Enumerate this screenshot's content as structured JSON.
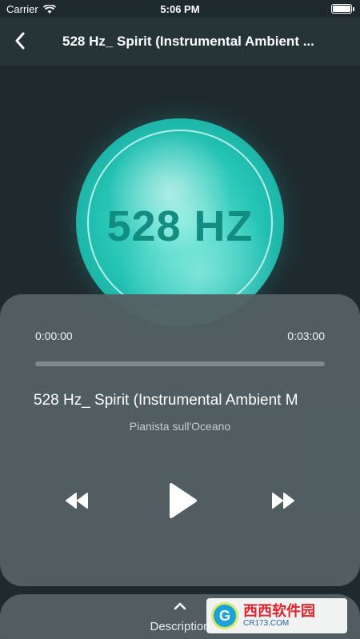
{
  "status_bar": {
    "carrier": "Carrier",
    "time": "5:06 PM",
    "icons": [
      "wifi-icon",
      "battery-icon"
    ]
  },
  "nav": {
    "back_icon": "chevron-left-icon",
    "title": "528 Hz_ Spirit (Instrumental Ambient ..."
  },
  "artwork": {
    "text": "528 HZ"
  },
  "player": {
    "current_time": "0:00:00",
    "total_time": "0:03:00",
    "progress_percent": 0,
    "track_title": "528 Hz_ Spirit (Instrumental Ambient M",
    "artist": "Pianista sull'Oceano",
    "controls": {
      "rewind_icon": "rewind-icon",
      "play_icon": "play-icon",
      "forward_icon": "fast-forward-icon"
    }
  },
  "description": {
    "icon": "chevron-up-icon",
    "label": "Description"
  },
  "watermark": {
    "logo_letter": "G",
    "main": "西西软件园",
    "sub": "CR173.COM"
  },
  "colors": {
    "background": "#1f2a2e",
    "nav_background": "#263337",
    "panel": "#536063",
    "artwork_teal": "#23c2b3",
    "artwork_text": "#138d82"
  }
}
